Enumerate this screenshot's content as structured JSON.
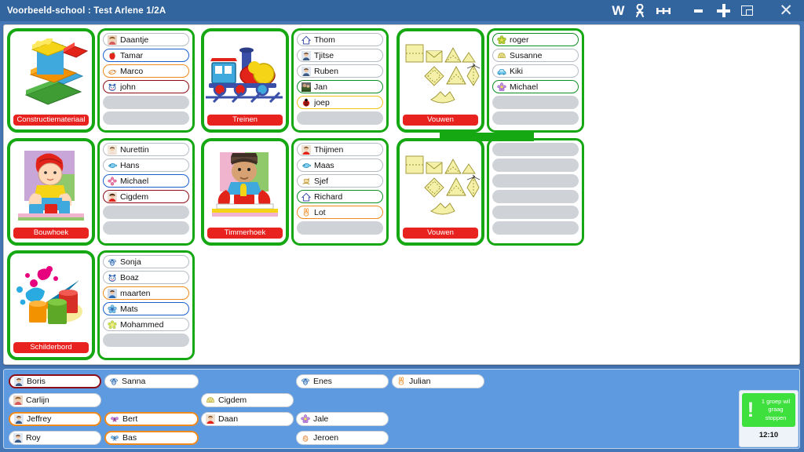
{
  "window": {
    "title": "Voorbeeld-school : Test Arlene 1/2A",
    "icons": [
      {
        "name": "word-icon",
        "glyph": "W"
      },
      {
        "name": "person-icon",
        "glyph": "☍"
      },
      {
        "name": "group-icon",
        "glyph": "ĦĦ"
      },
      {
        "name": "minimize-icon",
        "glyph": "–"
      },
      {
        "name": "maximize-plus-icon",
        "glyph": "+"
      },
      {
        "name": "restore-icon",
        "glyph": "❐"
      },
      {
        "name": "close-icon",
        "glyph": "✕"
      }
    ],
    "close_label": "✕"
  },
  "colors": {
    "titlebar": "#32659e",
    "tray": "#5e9ae0",
    "card_border": "#16a813",
    "label_red": "#e8231f",
    "alert_green": "#3ee03e"
  },
  "groups": [
    {
      "id": "constructiemateriaal",
      "label": "Constructiemateriaal",
      "icon": "lego-bricks-icon",
      "children": [
        {
          "name": "Daantje",
          "avatar": "photo-girl-icon",
          "border": "gray"
        },
        {
          "name": "Tamar",
          "avatar": "apple-icon",
          "border": "blue"
        },
        {
          "name": "Marco",
          "avatar": "bird-icon",
          "border": "orange"
        },
        {
          "name": "john",
          "avatar": "cow-icon",
          "border": "darkred"
        },
        {
          "name": "",
          "avatar": "",
          "border": "empty"
        },
        {
          "name": "",
          "avatar": "",
          "border": "empty"
        }
      ]
    },
    {
      "id": "treinen",
      "label": "Treinen",
      "icon": "steam-train-icon",
      "children": [
        {
          "name": "Thom",
          "avatar": "house-icon",
          "border": "gray"
        },
        {
          "name": "Tjitse",
          "avatar": "photo-boy-icon",
          "border": "gray"
        },
        {
          "name": "Ruben",
          "avatar": "photo-boy-icon",
          "border": "gray"
        },
        {
          "name": "Jan",
          "avatar": "photo-icon",
          "border": "green"
        },
        {
          "name": "joep",
          "avatar": "ladybug-icon",
          "border": "yellow"
        },
        {
          "name": "",
          "avatar": "",
          "border": "empty"
        }
      ]
    },
    {
      "id": "vouwen-1",
      "label": "Vouwen",
      "icon": "paper-folding-icon",
      "children": [
        {
          "name": "roger",
          "avatar": "flower-icon",
          "border": "green"
        },
        {
          "name": "Susanne",
          "avatar": "shell-icon",
          "border": "gray"
        },
        {
          "name": "Kiki",
          "avatar": "car-icon",
          "border": "gray"
        },
        {
          "name": "Michael",
          "avatar": "purple-flower-icon",
          "border": "green"
        },
        {
          "name": "",
          "avatar": "",
          "border": "empty"
        },
        {
          "name": "",
          "avatar": "",
          "border": "empty"
        }
      ]
    },
    {
      "id": "bouwhoek",
      "label": "Bouwhoek",
      "icon": "child-building-icon",
      "children": [
        {
          "name": "Nurettin",
          "avatar": "photo-child-icon",
          "border": "gray"
        },
        {
          "name": "Hans",
          "avatar": "fish-icon",
          "border": "gray"
        },
        {
          "name": "Michael",
          "avatar": "pink-flower-icon",
          "border": "blue"
        },
        {
          "name": "Cigdem",
          "avatar": "photo-girl-red-icon",
          "border": "darkred"
        },
        {
          "name": "",
          "avatar": "",
          "border": "empty"
        },
        {
          "name": "",
          "avatar": "",
          "border": "empty"
        }
      ]
    },
    {
      "id": "timmerhoek",
      "label": "Timmerhoek",
      "icon": "child-carpentry-icon",
      "children": [
        {
          "name": "Thijmen",
          "avatar": "photo-boy-red-icon",
          "border": "gray"
        },
        {
          "name": "Maas",
          "avatar": "fish-icon",
          "border": "gray"
        },
        {
          "name": "Sjef",
          "avatar": "rocking-horse-icon",
          "border": "gray"
        },
        {
          "name": "Richard",
          "avatar": "house-icon",
          "border": "green"
        },
        {
          "name": "Lot",
          "avatar": "rabbit-icon",
          "border": "orange"
        },
        {
          "name": "",
          "avatar": "",
          "border": "empty"
        }
      ]
    },
    {
      "id": "vouwen-2",
      "label": "Vouwen",
      "icon": "paper-folding-icon",
      "children": [
        {
          "name": "",
          "avatar": "",
          "border": "empty"
        },
        {
          "name": "",
          "avatar": "",
          "border": "empty"
        },
        {
          "name": "",
          "avatar": "",
          "border": "empty"
        },
        {
          "name": "",
          "avatar": "",
          "border": "empty"
        },
        {
          "name": "",
          "avatar": "",
          "border": "empty"
        },
        {
          "name": "",
          "avatar": "",
          "border": "empty"
        }
      ]
    },
    {
      "id": "schilderbord",
      "label": "Schilderbord",
      "icon": "paint-pots-icon",
      "children": [
        {
          "name": "Sonja",
          "avatar": "bee-icon",
          "border": "gray"
        },
        {
          "name": "Boaz",
          "avatar": "cow-icon",
          "border": "gray"
        },
        {
          "name": "maarten",
          "avatar": "photo-boy-blue-icon",
          "border": "orange"
        },
        {
          "name": "Mats",
          "avatar": "flower-blue-icon",
          "border": "blue"
        },
        {
          "name": "Mohammed",
          "avatar": "sun-flower-icon",
          "border": "gray"
        },
        {
          "name": "",
          "avatar": "",
          "border": "empty"
        }
      ]
    }
  ],
  "tray": {
    "columns": [
      {
        "items": [
          {
            "name": "Boris",
            "avatar": "photo-boy-icon",
            "border": "darkred"
          },
          {
            "name": "Carlijn",
            "avatar": "photo-girl-icon",
            "border": "gray"
          },
          {
            "name": "Jeffrey",
            "avatar": "photo-boy-icon",
            "border": "orange"
          },
          {
            "name": "Roy",
            "avatar": "photo-boy-icon",
            "border": "gray"
          }
        ]
      },
      {
        "items": [
          {
            "name": "Sanna",
            "avatar": "bee-icon",
            "border": "gray"
          },
          {
            "name": "",
            "avatar": "",
            "border": "spacer"
          },
          {
            "name": "Bert",
            "avatar": "butterfly-icon",
            "border": "orange"
          },
          {
            "name": "Bas",
            "avatar": "butterfly-blue-icon",
            "border": "orange"
          }
        ]
      },
      {
        "items": [
          {
            "name": "",
            "avatar": "",
            "border": "spacer"
          },
          {
            "name": "Cigdem",
            "avatar": "shell-icon",
            "border": "gray"
          },
          {
            "name": "Daan",
            "avatar": "photo-boy-red-icon",
            "border": "gray"
          },
          {
            "name": "",
            "avatar": "",
            "border": "spacer"
          }
        ]
      },
      {
        "items": [
          {
            "name": "Enes",
            "avatar": "bee-icon",
            "border": "gray"
          },
          {
            "name": "",
            "avatar": "",
            "border": "spacer"
          },
          {
            "name": "Jale",
            "avatar": "purple-flower-icon",
            "border": "gray"
          },
          {
            "name": "Jeroen",
            "avatar": "chick-icon",
            "border": "gray"
          }
        ]
      },
      {
        "items": [
          {
            "name": "Julian",
            "avatar": "rabbit-icon",
            "border": "gray"
          },
          {
            "name": "",
            "avatar": "",
            "border": "spacer"
          },
          {
            "name": "",
            "avatar": "",
            "border": "spacer"
          },
          {
            "name": "",
            "avatar": "",
            "border": "spacer"
          }
        ]
      }
    ]
  },
  "alert": {
    "icon": "exclamation-icon",
    "message": "1 groep wil graag stoppen",
    "time": "12:10"
  }
}
